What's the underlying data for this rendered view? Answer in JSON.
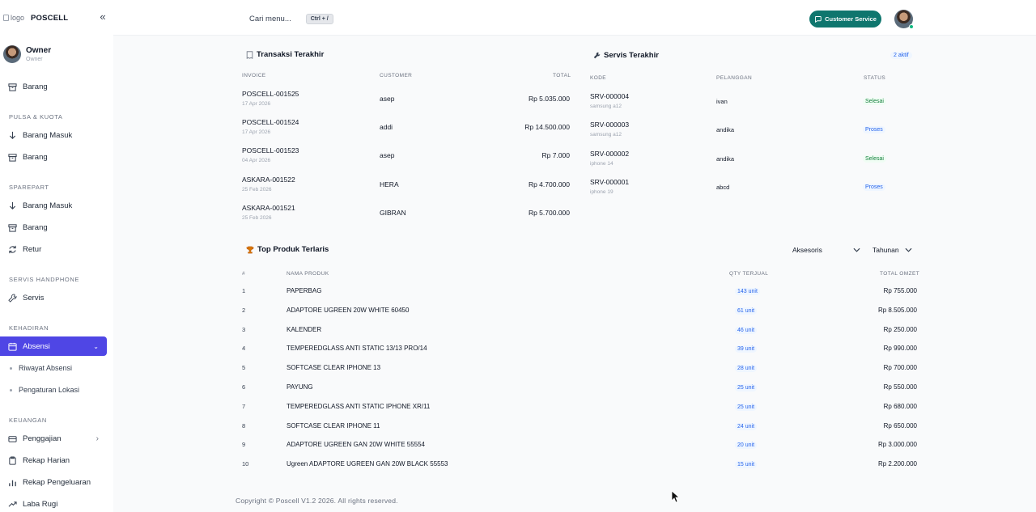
{
  "brand": {
    "logo_alt": "logo",
    "name": "POSCELL"
  },
  "user": {
    "name": "Owner",
    "role": "Owner"
  },
  "sidebar": {
    "top_item": {
      "label": "Barang",
      "icon": "box-icon"
    },
    "sections": [
      {
        "title": "PULSA & KUOTA",
        "items": [
          {
            "label": "Barang Masuk",
            "icon": "arrow-down-icon"
          },
          {
            "label": "Barang",
            "icon": "box-icon"
          }
        ]
      },
      {
        "title": "SPAREPART",
        "items": [
          {
            "label": "Barang Masuk",
            "icon": "arrow-down-icon"
          },
          {
            "label": "Barang",
            "icon": "box-icon"
          },
          {
            "label": "Retur",
            "icon": "refresh-icon"
          }
        ]
      },
      {
        "title": "SERVIS HANDPHONE",
        "items": [
          {
            "label": "Servis",
            "icon": "wrench-icon"
          }
        ]
      },
      {
        "title": "KEHADIRAN",
        "items": [
          {
            "label": "Absensi",
            "icon": "calendar-icon",
            "active": true
          }
        ],
        "subitems": [
          "Riwayat Absensi",
          "Pengaturan Lokasi"
        ]
      },
      {
        "title": "KEUANGAN",
        "items": [
          {
            "label": "Penggajian",
            "icon": "wallet-icon"
          },
          {
            "label": "Rekap Harian",
            "icon": "clipboard-icon"
          },
          {
            "label": "Rekap Pengeluaran",
            "icon": "bar-chart-icon"
          },
          {
            "label": "Laba Rugi",
            "icon": "trend-icon"
          }
        ]
      }
    ]
  },
  "topbar": {
    "search_placeholder": "Cari menu...",
    "shortcut": "Ctrl + /",
    "cs_label": "Customer Service"
  },
  "transaksi": {
    "title": "Transaksi Terakhir",
    "headers": {
      "invoice": "INVOICE",
      "customer": "CUSTOMER",
      "total": "TOTAL"
    },
    "rows": [
      {
        "invoice": "POSCELL-001525",
        "date": "17 Apr 2026",
        "customer": "asep",
        "total": "Rp 5.035.000"
      },
      {
        "invoice": "POSCELL-001524",
        "date": "17 Apr 2026",
        "customer": "addi",
        "total": "Rp 14.500.000"
      },
      {
        "invoice": "POSCELL-001523",
        "date": "04 Apr 2026",
        "customer": "asep",
        "total": "Rp 7.000"
      },
      {
        "invoice": "ASKARA-001522",
        "date": "25 Feb 2026",
        "customer": "HERA",
        "total": "Rp 4.700.000"
      },
      {
        "invoice": "ASKARA-001521",
        "date": "25 Feb 2026",
        "customer": "GIBRAN",
        "total": "Rp 5.700.000"
      }
    ]
  },
  "servis": {
    "title": "Servis Terakhir",
    "badge": "2 aktif",
    "headers": {
      "kode": "KODE",
      "pelanggan": "PELANGGAN",
      "status": "STATUS"
    },
    "rows": [
      {
        "kode": "SRV-000004",
        "device": "samsung a12",
        "pelanggan": "ivan",
        "status": "Selesai"
      },
      {
        "kode": "SRV-000003",
        "device": "samsung a12",
        "pelanggan": "andika",
        "status": "Proses"
      },
      {
        "kode": "SRV-000002",
        "device": "iphone 14",
        "pelanggan": "andika",
        "status": "Selesai"
      },
      {
        "kode": "SRV-000001",
        "device": "iphone 19",
        "pelanggan": "abcd",
        "status": "Proses"
      }
    ]
  },
  "top_produk": {
    "title": "Top Produk Terlaris",
    "filter_category": "Aksesoris",
    "filter_period": "Tahunan",
    "headers": {
      "no": "#",
      "nama": "NAMA PRODUK",
      "qty": "QTY TERJUAL",
      "omzet": "TOTAL OMZET"
    },
    "rows": [
      {
        "no": "1",
        "nama": "PAPERBAG",
        "qty": "143 unit",
        "omzet": "Rp 755.000"
      },
      {
        "no": "2",
        "nama": "ADAPTORE UGREEN 20W WHITE 60450",
        "qty": "61 unit",
        "omzet": "Rp 8.505.000"
      },
      {
        "no": "3",
        "nama": "KALENDER",
        "qty": "46 unit",
        "omzet": "Rp 250.000"
      },
      {
        "no": "4",
        "nama": "TEMPEREDGLASS ANTI STATIC 13/13 PRO/14",
        "qty": "39 unit",
        "omzet": "Rp 990.000"
      },
      {
        "no": "5",
        "nama": "SOFTCASE CLEAR IPHONE 13",
        "qty": "28 unit",
        "omzet": "Rp 700.000"
      },
      {
        "no": "6",
        "nama": "PAYUNG",
        "qty": "25 unit",
        "omzet": "Rp 550.000"
      },
      {
        "no": "7",
        "nama": "TEMPEREDGLASS ANTI STATIC IPHONE XR/11",
        "qty": "25 unit",
        "omzet": "Rp 680.000"
      },
      {
        "no": "8",
        "nama": "SOFTCASE CLEAR IPHONE 11",
        "qty": "24 unit",
        "omzet": "Rp 650.000"
      },
      {
        "no": "9",
        "nama": "ADAPTORE UGREEN GAN 20W WHITE 55554",
        "qty": "20 unit",
        "omzet": "Rp 3.000.000"
      },
      {
        "no": "10",
        "nama": "Ugreen ADAPTORE UGREEN GAN 20W BLACK 55553",
        "qty": "15 unit",
        "omzet": "Rp 2.200.000"
      }
    ]
  },
  "footer": {
    "text": "Copyright © Poscell V1.2 2026. All rights reserved."
  },
  "colors": {
    "accent": "#4f46e5",
    "cs_button": "#0f766e",
    "status_done": "#15803d",
    "status_process": "#2563eb"
  }
}
